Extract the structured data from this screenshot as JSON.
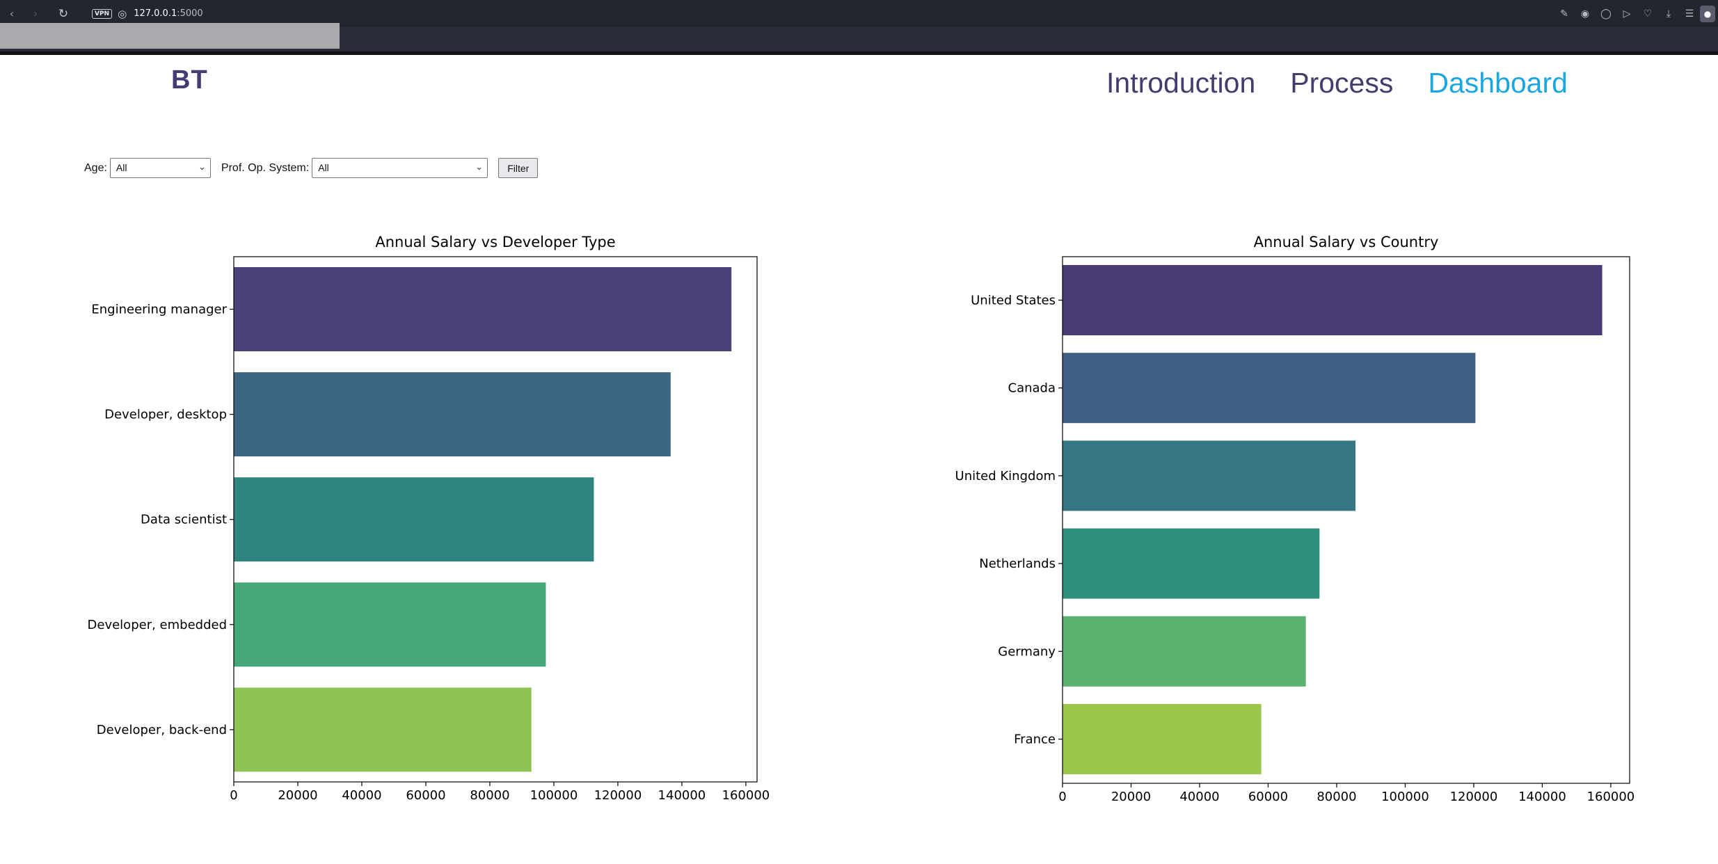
{
  "browser": {
    "back_icon": "chevron-left-icon",
    "forward_icon": "chevron-right-icon",
    "reload_icon": "reload-icon",
    "vpn_badge": "VPN",
    "url_host": "127.0.0.1",
    "url_port": ":5000",
    "right_icons": [
      "share-icon",
      "camera-icon",
      "shield-icon",
      "play-icon",
      "heart-icon",
      "download-icon",
      "menu-icon",
      "profile-icon"
    ]
  },
  "site": {
    "logo": "BT",
    "nav": [
      {
        "label": "Introduction",
        "active": false
      },
      {
        "label": "Process",
        "active": false
      },
      {
        "label": "Dashboard",
        "active": true
      }
    ],
    "accent_color": "#1aa6e0",
    "nav_color": "#433d6e"
  },
  "filters": {
    "age_label": "Age:",
    "age_value": "All",
    "os_label": "Prof. Op. System:",
    "os_value": "All",
    "button_label": "Filter"
  },
  "chart_data": [
    {
      "type": "bar",
      "orientation": "horizontal",
      "title": "Annual Salary vs Developer Type",
      "categories": [
        "Engineering manager",
        "Developer, desktop",
        "Data scientist",
        "Developer, embedded",
        "Developer, back-end"
      ],
      "values": [
        155500,
        136500,
        112500,
        97500,
        93000
      ],
      "colors": [
        "#4a437a",
        "#3d6682",
        "#2f8480",
        "#46a878",
        "#8fc454"
      ],
      "xticks": [
        0,
        20000,
        40000,
        60000,
        80000,
        100000,
        120000,
        140000,
        160000
      ],
      "xlim": [
        0,
        163500
      ],
      "grid": false
    },
    {
      "type": "bar",
      "orientation": "horizontal",
      "title": "Annual Salary vs Country",
      "categories": [
        "United States",
        "Canada",
        "United Kingdom",
        "Netherlands",
        "Germany",
        "France"
      ],
      "values": [
        157500,
        120500,
        85500,
        75000,
        71000,
        58000
      ],
      "colors": [
        "#4a3a76",
        "#415f85",
        "#347783",
        "#2f917d",
        "#5ab170",
        "#9bc44a"
      ],
      "xticks": [
        0,
        20000,
        40000,
        60000,
        80000,
        100000,
        120000,
        140000,
        160000
      ],
      "xlim": [
        0,
        165500
      ],
      "grid": false
    }
  ]
}
